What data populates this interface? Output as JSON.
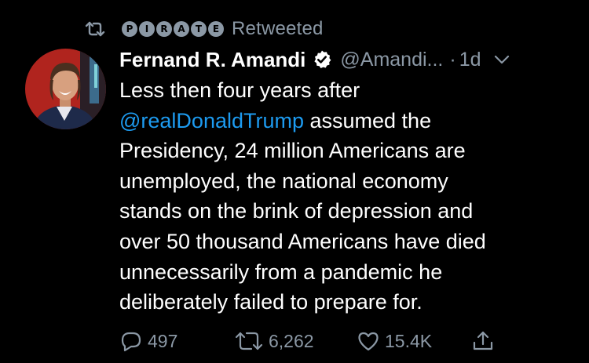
{
  "retweet_banner": {
    "icon": "retweet-icon",
    "badge_letters": [
      "P",
      "I",
      "R",
      "A",
      "T",
      "E"
    ],
    "label": "Retweeted"
  },
  "tweet": {
    "author": {
      "display_name": "Fernand R. Amandi",
      "verified": true,
      "handle": "@Amandi...",
      "avatar": "avatar-photo"
    },
    "separator": "·",
    "time": "1d",
    "text_lines": [
      {
        "plain": "Less then four years after"
      },
      {
        "mention": "@realDonaldTrump",
        "plain": " assumed the"
      },
      {
        "plain": "Presidency, 24 million Americans are"
      },
      {
        "plain": "unemployed, the national economy"
      },
      {
        "plain": "stands on the brink of depression and"
      },
      {
        "plain": "over 50 thousand Americans have died"
      },
      {
        "plain": "unnecessarily from a pandemic he"
      },
      {
        "plain": "deliberately failed to prepare for."
      }
    ],
    "actions": {
      "reply_count": "497",
      "retweet_count": "6,262",
      "like_count": "15.4K"
    }
  },
  "colors": {
    "background": "#000000",
    "text": "#ffffff",
    "secondary": "#8b98a5",
    "link": "#1d9bf0",
    "verified_badge": "#ffffff"
  }
}
